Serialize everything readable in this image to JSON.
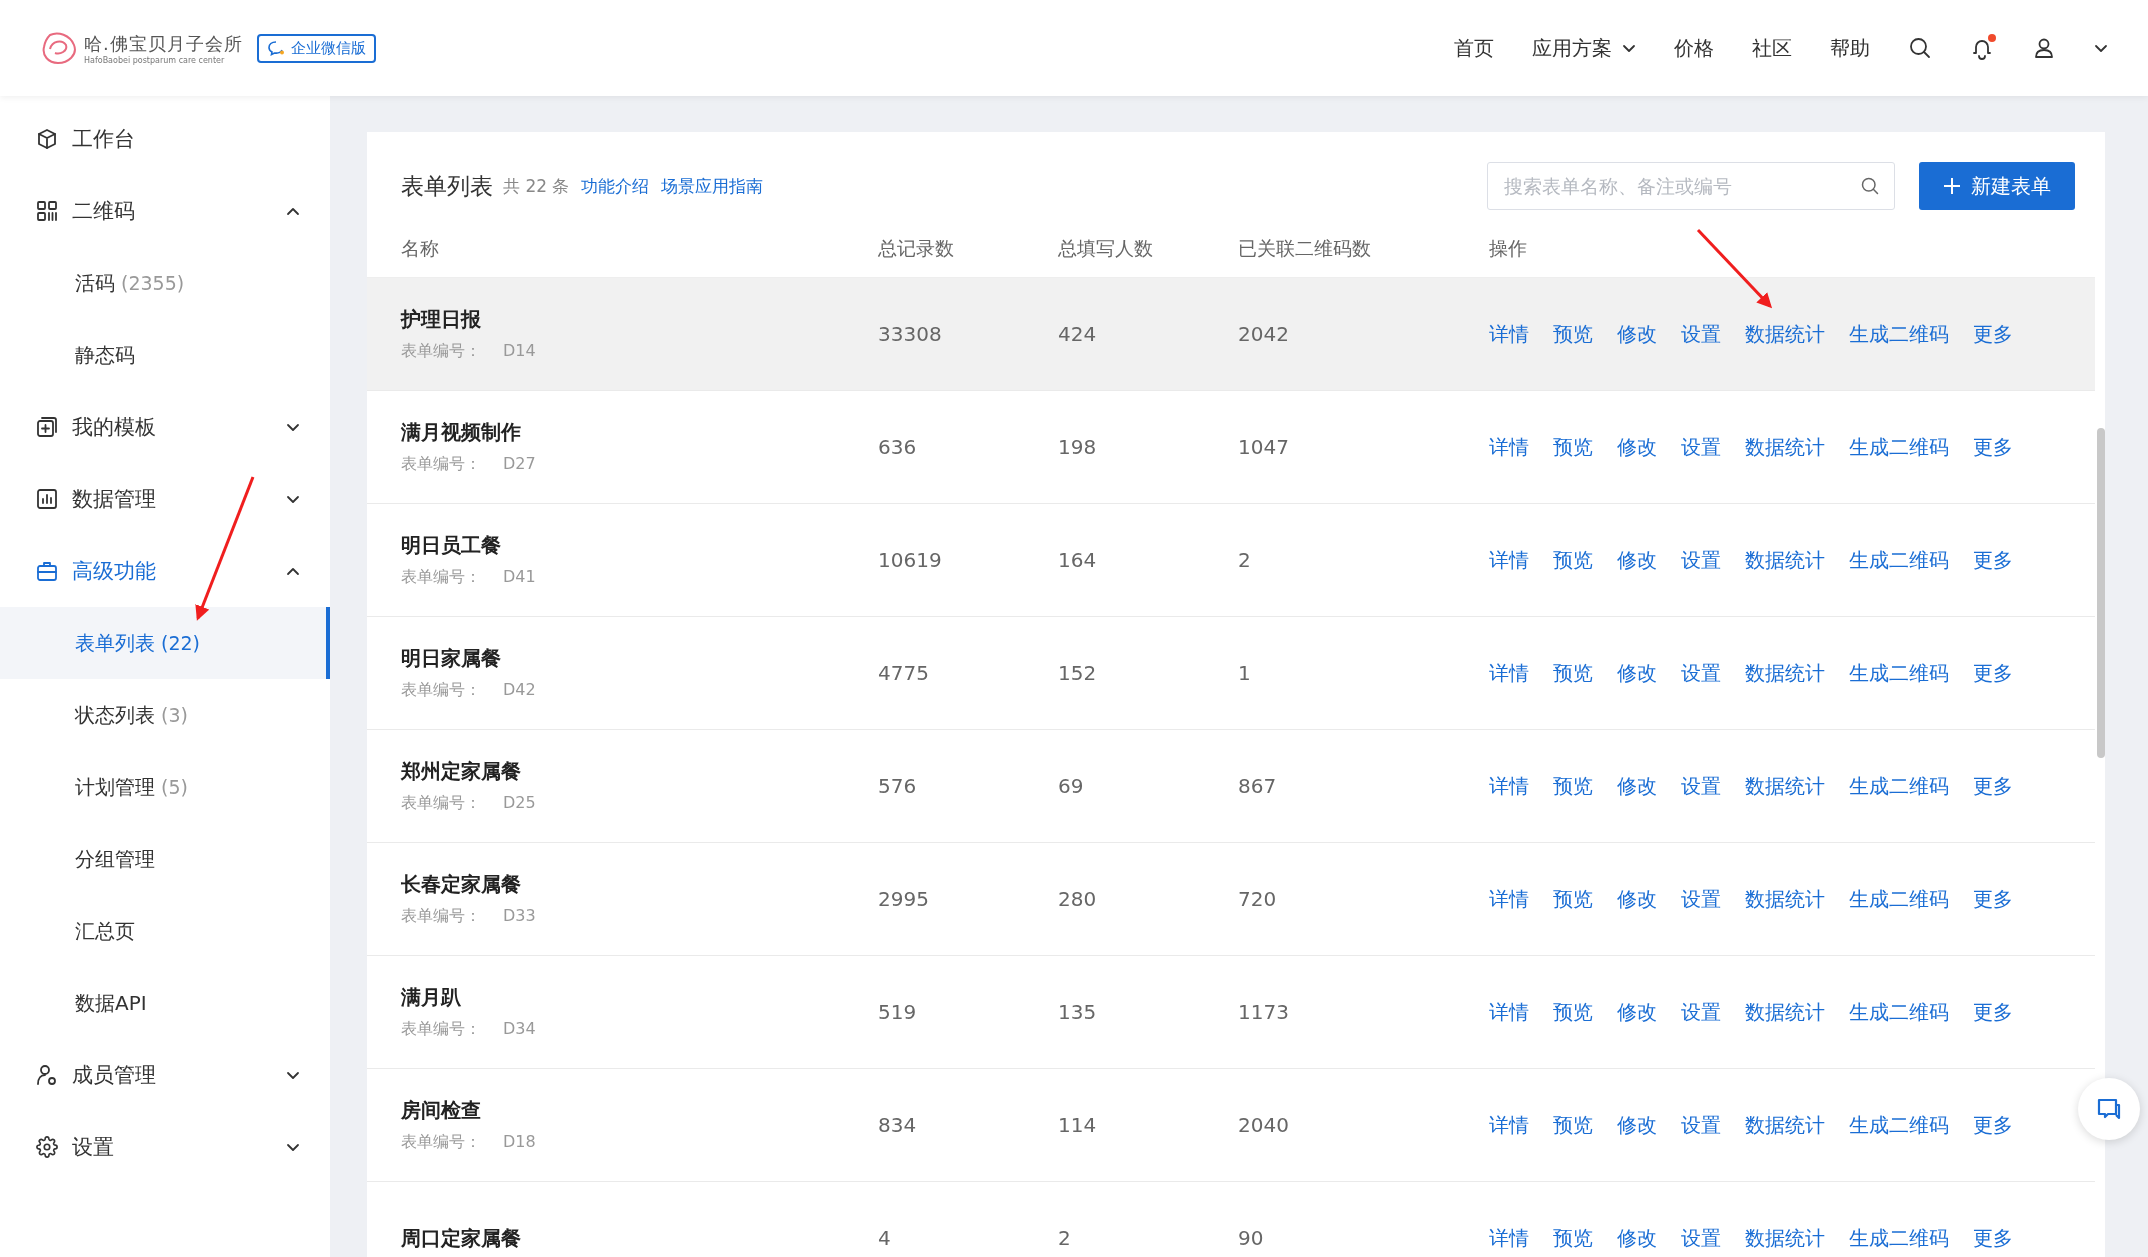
{
  "header": {
    "logo": {
      "name": "哈.佛宝贝月子会所",
      "subtitle": "HafoBaobei postparum care center"
    },
    "edition_badge": "企业微信版",
    "nav": [
      {
        "label": "首页",
        "dropdown": false
      },
      {
        "label": "应用方案",
        "dropdown": true
      },
      {
        "label": "价格",
        "dropdown": false
      },
      {
        "label": "社区",
        "dropdown": false
      },
      {
        "label": "帮助",
        "dropdown": false
      }
    ],
    "notification_dot": true
  },
  "sidebar": {
    "items": [
      {
        "label": "工作台",
        "selected": false
      },
      {
        "label": "二维码",
        "selected": false,
        "expanded": true,
        "children": [
          {
            "label": "活码",
            "count": "(2355)",
            "selected": false
          },
          {
            "label": "静态码",
            "selected": false
          }
        ]
      },
      {
        "label": "我的模板",
        "selected": false,
        "expanded": false
      },
      {
        "label": "数据管理",
        "selected": false,
        "expanded": false
      },
      {
        "label": "高级功能",
        "selected": true,
        "expanded": true,
        "children": [
          {
            "label": "表单列表",
            "count": "(22)",
            "selected": true
          },
          {
            "label": "状态列表",
            "count": "(3)",
            "selected": false
          },
          {
            "label": "计划管理",
            "count": "(5)",
            "selected": false
          },
          {
            "label": "分组管理",
            "selected": false
          },
          {
            "label": "汇总页",
            "selected": false
          },
          {
            "label": "数据API",
            "selected": false
          }
        ]
      },
      {
        "label": "成员管理",
        "selected": false,
        "expanded": false
      },
      {
        "label": "设置",
        "selected": false,
        "expanded": false
      }
    ]
  },
  "panel": {
    "title": "表单列表",
    "total": "共 22 条",
    "links": [
      "功能介绍",
      "场景应用指南"
    ],
    "search": {
      "placeholder": "搜索表单名称、备注或编号"
    },
    "new_button": "新建表单"
  },
  "table": {
    "columns": [
      "名称",
      "总记录数",
      "总填写人数",
      "已关联二维码数",
      "操作"
    ],
    "rows": [
      {
        "name": "护理日报",
        "code_label": "表单编号：",
        "code": "D14",
        "records": "33308",
        "fillers": "424",
        "qrcodes": "2042",
        "hovered": true,
        "actions": [
          "详情",
          "预览",
          "修改",
          "设置",
          "数据统计",
          "生成二维码",
          "更多"
        ]
      },
      {
        "name": "满月视频制作",
        "code_label": "表单编号：",
        "code": "D27",
        "records": "636",
        "fillers": "198",
        "qrcodes": "1047",
        "hovered": false,
        "actions": [
          "详情",
          "预览",
          "修改",
          "设置",
          "数据统计",
          "生成二维码",
          "更多"
        ]
      },
      {
        "name": "明日员工餐",
        "code_label": "表单编号：",
        "code": "D41",
        "records": "10619",
        "fillers": "164",
        "qrcodes": "2",
        "hovered": false,
        "actions": [
          "详情",
          "预览",
          "修改",
          "设置",
          "数据统计",
          "生成二维码",
          "更多"
        ]
      },
      {
        "name": "明日家属餐",
        "code_label": "表单编号：",
        "code": "D42",
        "records": "4775",
        "fillers": "152",
        "qrcodes": "1",
        "hovered": false,
        "actions": [
          "详情",
          "预览",
          "修改",
          "设置",
          "数据统计",
          "生成二维码",
          "更多"
        ]
      },
      {
        "name": "郑州定家属餐",
        "code_label": "表单编号：",
        "code": "D25",
        "records": "576",
        "fillers": "69",
        "qrcodes": "867",
        "hovered": false,
        "actions": [
          "详情",
          "预览",
          "修改",
          "设置",
          "数据统计",
          "生成二维码",
          "更多"
        ]
      },
      {
        "name": "长春定家属餐",
        "code_label": "表单编号：",
        "code": "D33",
        "records": "2995",
        "fillers": "280",
        "qrcodes": "720",
        "hovered": false,
        "actions": [
          "详情",
          "预览",
          "修改",
          "设置",
          "数据统计",
          "生成二维码",
          "更多"
        ]
      },
      {
        "name": "满月趴",
        "code_label": "表单编号：",
        "code": "D34",
        "records": "519",
        "fillers": "135",
        "qrcodes": "1173",
        "hovered": false,
        "actions": [
          "详情",
          "预览",
          "修改",
          "设置",
          "数据统计",
          "生成二维码",
          "更多"
        ]
      },
      {
        "name": "房间检查",
        "code_label": "表单编号：",
        "code": "D18",
        "records": "834",
        "fillers": "114",
        "qrcodes": "2040",
        "hovered": false,
        "actions": [
          "详情",
          "预览",
          "修改",
          "设置",
          "数据统计",
          "生成二维码",
          "更多"
        ]
      },
      {
        "name": "周口定家属餐",
        "records": "4",
        "fillers": "2",
        "qrcodes": "90",
        "hovered": false,
        "actions": [
          "详情",
          "预览",
          "修改",
          "设置",
          "数据统计",
          "生成二维码",
          "更多"
        ]
      }
    ]
  }
}
